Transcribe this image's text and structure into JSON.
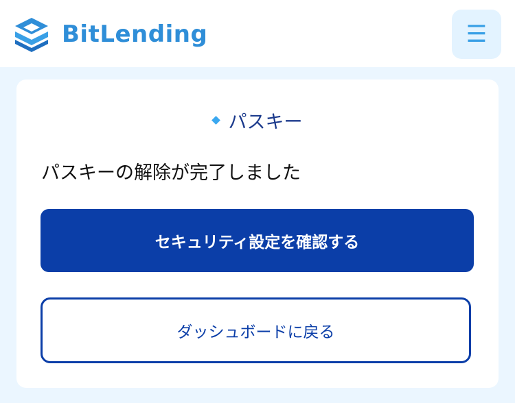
{
  "header": {
    "brand": "BitLending",
    "menu_icon": "hamburger-icon",
    "menu_glyph": "☰"
  },
  "card": {
    "title": "パスキー",
    "message": "パスキーの解除が完了しました",
    "primary_button": "セキュリティ設定を確認する",
    "secondary_button": "ダッシュボードに戻る"
  },
  "colors": {
    "brand": "#2f8ed8",
    "primary": "#0b3ea8",
    "page_bg": "#ebf6ff",
    "menu_bg": "#e3f3ff"
  }
}
